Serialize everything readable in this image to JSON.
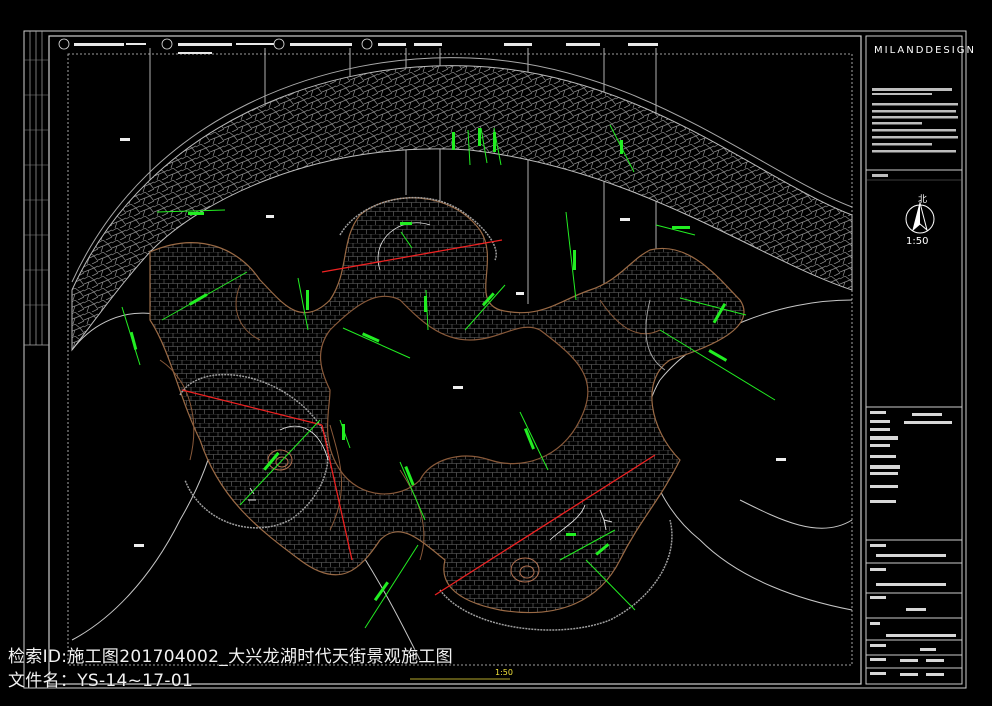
{
  "watermark": {
    "line1": "检索ID:施工图201704002_大兴龙湖时代天街景观施工图",
    "line2": "文件名：YS-14~17-01"
  },
  "title_block": {
    "brand": "MILANDDESIGN",
    "scale": "1:50",
    "north": "北"
  },
  "drawing_footer": {
    "scale": "1:50"
  },
  "dimension_labels": [
    "R500",
    "R2900",
    "R1300",
    "R1850",
    "R900",
    "R1750",
    "R2900",
    "R3300",
    "R2200",
    "R2500",
    "R2800",
    "R4100",
    "R1350",
    "R1500",
    "R2800",
    "R2500",
    "R2300",
    "R2000",
    "R4550",
    "R2600",
    "R2300",
    "R4200",
    "R3400",
    "R3900",
    "R2050",
    "R950",
    "R2800",
    "R1000",
    "R1250",
    "R1450",
    "R2100",
    "R1400",
    "R2750"
  ],
  "colors": {
    "background": "#000000",
    "dimension": "#22ee22",
    "section_cut": "#ee2222",
    "outline": "#bbbbbb",
    "paving": "#7a7a7a",
    "paving_brown": "#8a5a3a",
    "watermark": "#f2f2f2",
    "footer_text": "#f0e23a"
  }
}
